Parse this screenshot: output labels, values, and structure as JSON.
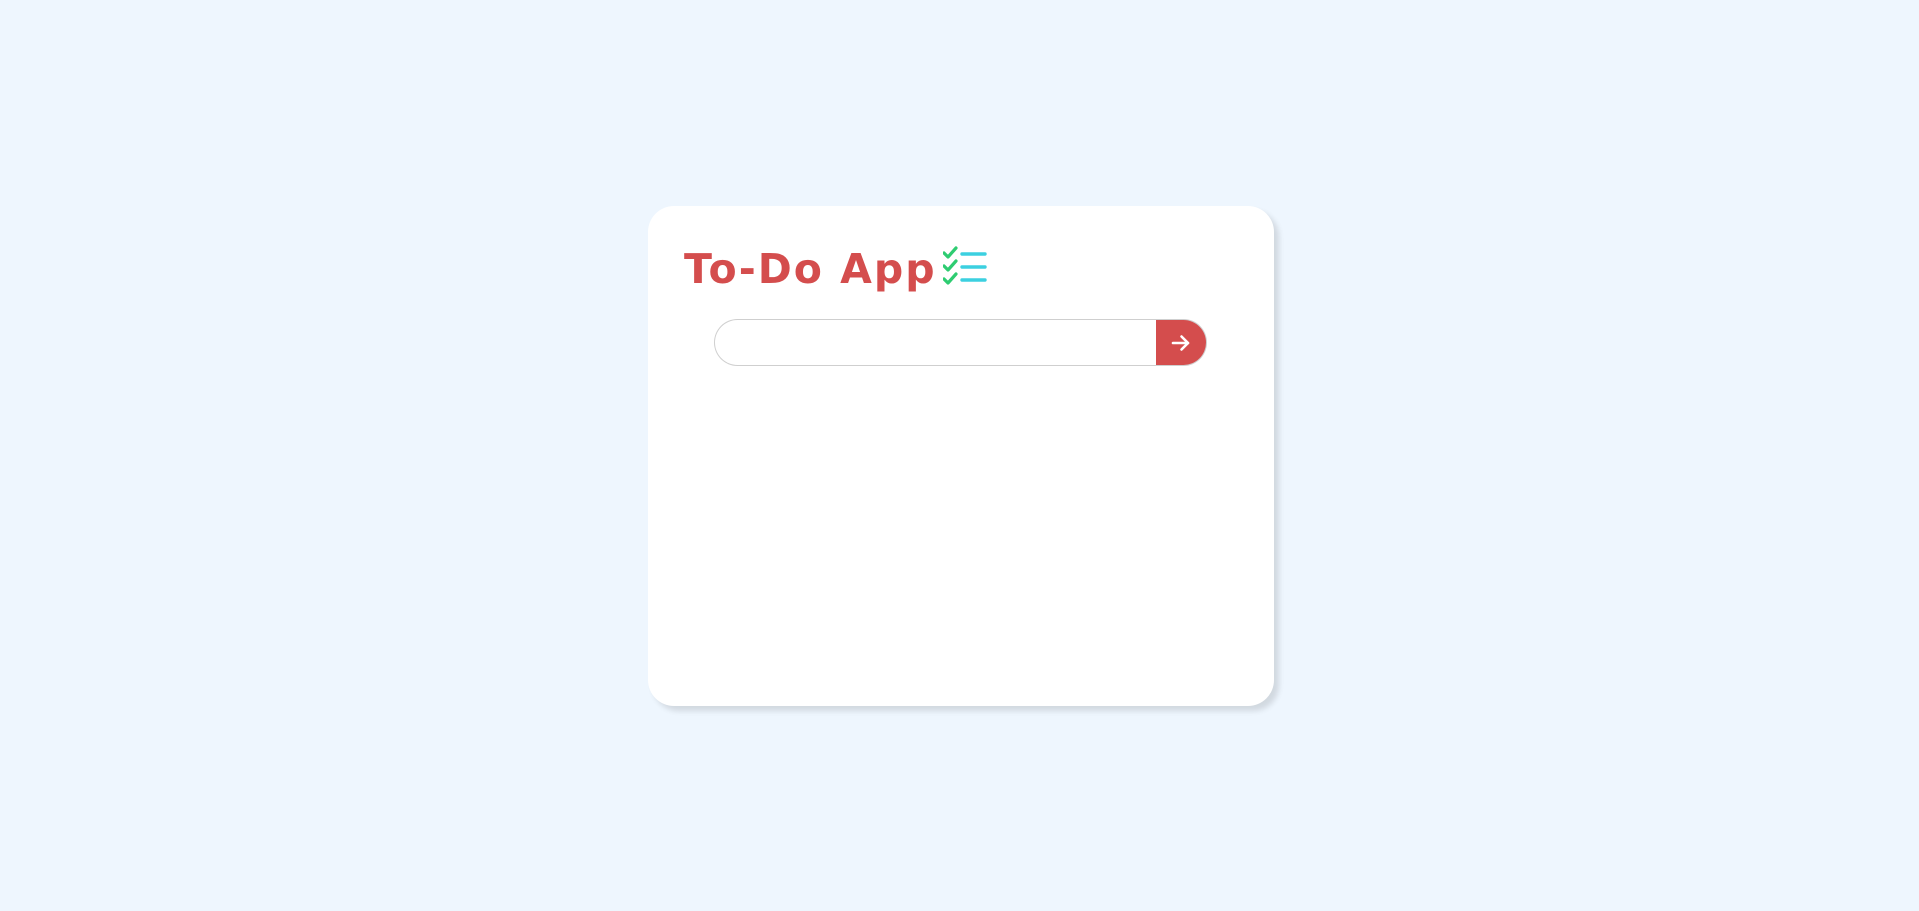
{
  "app": {
    "title": "To-Do App",
    "title_icon": "checklist-icon"
  },
  "todo_input": {
    "value": "",
    "placeholder": ""
  },
  "add_button": {
    "icon": "arrow-right-icon"
  },
  "colors": {
    "page_background": "#eef6fe",
    "card_background": "#ffffff",
    "accent": "#d44d4d",
    "check_green": "#2ecc71",
    "list_cyan": "#3cd0e0",
    "input_border": "#cfcfcf"
  },
  "todo_items": []
}
